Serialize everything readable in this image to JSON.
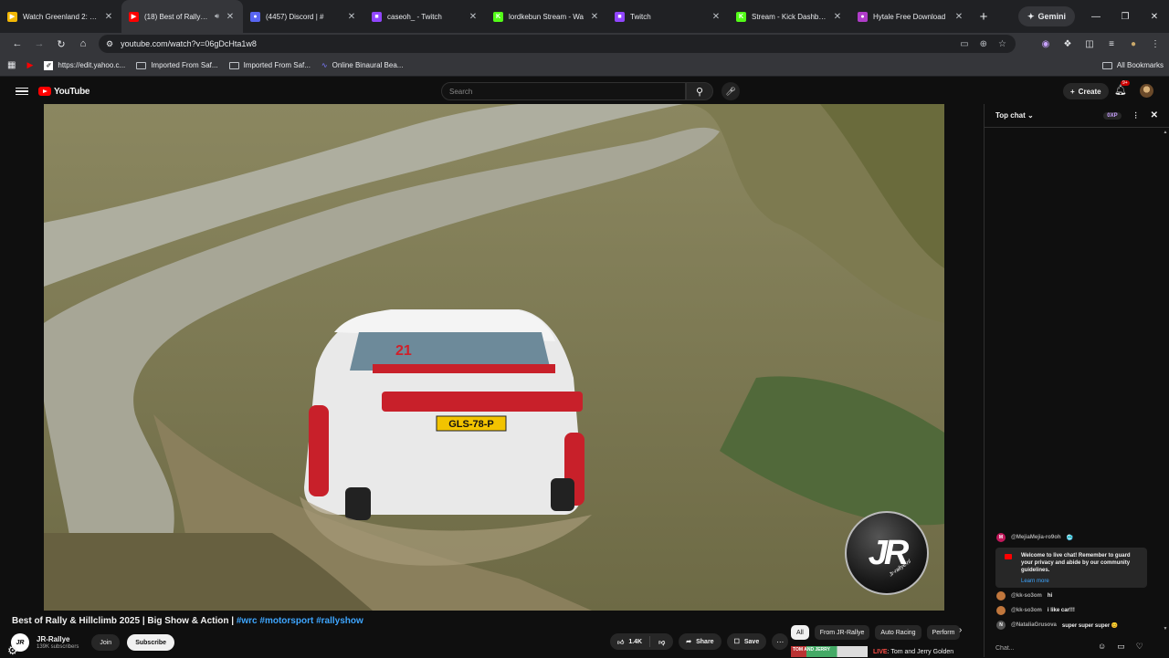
{
  "browser": {
    "tabs": [
      {
        "title": "Watch Greenland 2: Mig",
        "icon": "play-icon",
        "color": "#f2b705",
        "glyph": "▶"
      },
      {
        "title": "(18) Best of Rally & Hi",
        "icon": "youtube-icon",
        "color": "#ff0000",
        "glyph": "▶",
        "active": true
      },
      {
        "title": "(4457) Discord | #",
        "icon": "discord-icon",
        "color": "#5865f2",
        "glyph": "●"
      },
      {
        "title": "caseoh_ - Twitch",
        "icon": "twitch-icon",
        "color": "#9146ff",
        "glyph": "■"
      },
      {
        "title": "lordkebun Stream - Wa",
        "icon": "kick-icon",
        "color": "#53fc18",
        "glyph": "K"
      },
      {
        "title": "Twitch",
        "icon": "twitch-icon",
        "color": "#9146ff",
        "glyph": "■"
      },
      {
        "title": "Stream - Kick Dashboa",
        "icon": "kick-icon",
        "color": "#53fc18",
        "glyph": "K"
      },
      {
        "title": "Hytale Free Download",
        "icon": "hytale-icon",
        "color": "#b03cc9",
        "glyph": "●"
      }
    ],
    "gemini_label": "Gemini",
    "url": "youtube.com/watch?v=06gDcHta1w8",
    "bookmarks": [
      {
        "label": "https://edit.yahoo.c...",
        "icon": "yahoo-icon"
      },
      {
        "label": "Imported From Saf...",
        "icon": "folder-icon"
      },
      {
        "label": "Imported From Saf...",
        "icon": "folder-icon"
      },
      {
        "label": "Online Binaural Bea...",
        "icon": "wave-icon"
      }
    ],
    "all_bookmarks": "All Bookmarks"
  },
  "youtube": {
    "logo": "YouTube",
    "search_placeholder": "Search",
    "create_label": "Create",
    "notif_count": "9+",
    "video": {
      "title": "Best of Rally & Hillclimb 2025 | Big Show & Action | ",
      "hashtags": "#wrc #motorsport #rallyshow",
      "watermark": "JR",
      "watermark_sub": "Jr-rallye.nl",
      "plate": "GLS-78-P",
      "car_number": "21"
    },
    "channel": {
      "name": "JR-Rallye",
      "subscribers": "139K subscribers",
      "avatar_text": "JR"
    },
    "join_label": "Join",
    "subscribe_label": "Subscribe",
    "likes": "1.4K",
    "share_label": "Share",
    "save_label": "Save",
    "chips": [
      "All",
      "From JR-Rallye",
      "Auto Racing",
      "Perform"
    ],
    "rec_live": "LIVE",
    "rec_title": ": Tom and Jerry Golden",
    "rec_thumb_text": "TOM AND JERRY"
  },
  "chat": {
    "header": "Top chat",
    "xp": "0XP",
    "messages": [
      {
        "author": "@MejiaMejia-ro9oh",
        "text": "🥶",
        "avatar": "M",
        "color": "#c2185b"
      },
      {
        "author": "@kk-so3om",
        "text": "hi",
        "avatar": "",
        "color": "#c0763c"
      },
      {
        "author": "@kk-so3om",
        "text": "i like car!!!",
        "avatar": "",
        "color": "#c0763c"
      },
      {
        "author": "@NataliaGrusova",
        "text": "super super super 😊",
        "avatar": "N",
        "color": "#555"
      }
    ],
    "welcome": "Welcome to live chat! Remember to guard your privacy and abide by our community guidelines.",
    "learn_more": "Learn more",
    "input_placeholder": "Chat..."
  }
}
